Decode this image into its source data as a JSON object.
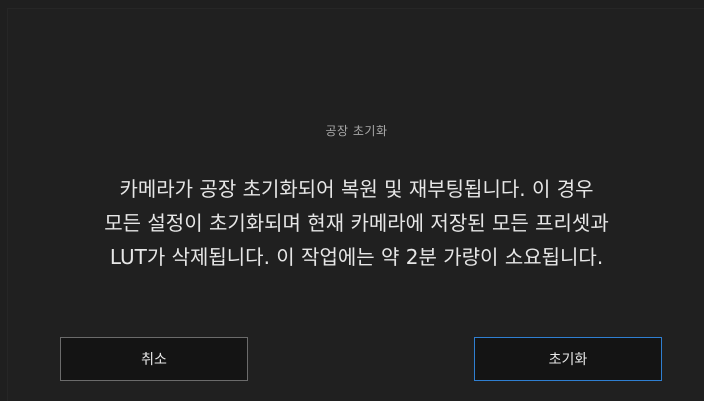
{
  "dialog": {
    "title": "공장 초기화",
    "message_lines": [
      "카메라가 공장 초기화되어 복원 및 재부팅됩니다. 이 경우",
      "모든 설정이 초기화되며 현재 카메라에 저장된 모든 프리셋과",
      "LUT가 삭제됩니다. 이 작업에는 약 2분 가량이 소요됩니다."
    ],
    "cancel_label": "취소",
    "confirm_label": "초기화"
  },
  "colors": {
    "background": "#1f1f1f",
    "confirm_border": "#2f7fd1",
    "cancel_border": "#6b6b6b"
  }
}
